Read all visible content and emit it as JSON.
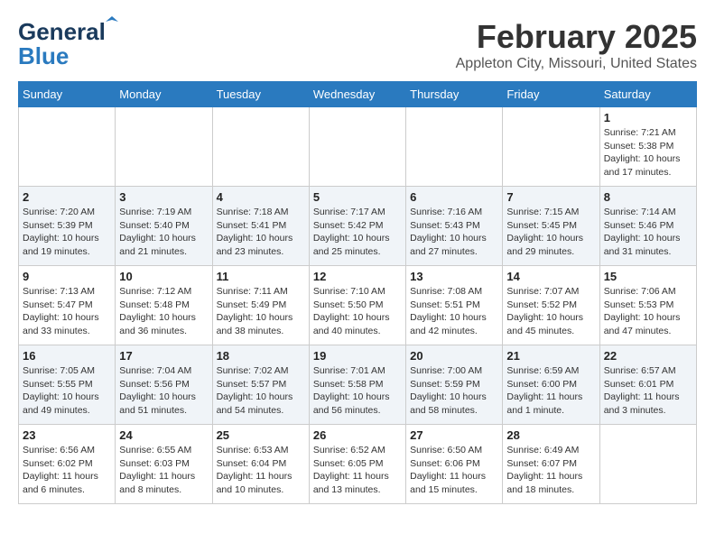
{
  "header": {
    "logo_general": "General",
    "logo_blue": "Blue",
    "month_year": "February 2025",
    "location": "Appleton City, Missouri, United States"
  },
  "weekdays": [
    "Sunday",
    "Monday",
    "Tuesday",
    "Wednesday",
    "Thursday",
    "Friday",
    "Saturday"
  ],
  "weeks": [
    [
      {
        "day": "",
        "info": ""
      },
      {
        "day": "",
        "info": ""
      },
      {
        "day": "",
        "info": ""
      },
      {
        "day": "",
        "info": ""
      },
      {
        "day": "",
        "info": ""
      },
      {
        "day": "",
        "info": ""
      },
      {
        "day": "1",
        "info": "Sunrise: 7:21 AM\nSunset: 5:38 PM\nDaylight: 10 hours\nand 17 minutes."
      }
    ],
    [
      {
        "day": "2",
        "info": "Sunrise: 7:20 AM\nSunset: 5:39 PM\nDaylight: 10 hours\nand 19 minutes."
      },
      {
        "day": "3",
        "info": "Sunrise: 7:19 AM\nSunset: 5:40 PM\nDaylight: 10 hours\nand 21 minutes."
      },
      {
        "day": "4",
        "info": "Sunrise: 7:18 AM\nSunset: 5:41 PM\nDaylight: 10 hours\nand 23 minutes."
      },
      {
        "day": "5",
        "info": "Sunrise: 7:17 AM\nSunset: 5:42 PM\nDaylight: 10 hours\nand 25 minutes."
      },
      {
        "day": "6",
        "info": "Sunrise: 7:16 AM\nSunset: 5:43 PM\nDaylight: 10 hours\nand 27 minutes."
      },
      {
        "day": "7",
        "info": "Sunrise: 7:15 AM\nSunset: 5:45 PM\nDaylight: 10 hours\nand 29 minutes."
      },
      {
        "day": "8",
        "info": "Sunrise: 7:14 AM\nSunset: 5:46 PM\nDaylight: 10 hours\nand 31 minutes."
      }
    ],
    [
      {
        "day": "9",
        "info": "Sunrise: 7:13 AM\nSunset: 5:47 PM\nDaylight: 10 hours\nand 33 minutes."
      },
      {
        "day": "10",
        "info": "Sunrise: 7:12 AM\nSunset: 5:48 PM\nDaylight: 10 hours\nand 36 minutes."
      },
      {
        "day": "11",
        "info": "Sunrise: 7:11 AM\nSunset: 5:49 PM\nDaylight: 10 hours\nand 38 minutes."
      },
      {
        "day": "12",
        "info": "Sunrise: 7:10 AM\nSunset: 5:50 PM\nDaylight: 10 hours\nand 40 minutes."
      },
      {
        "day": "13",
        "info": "Sunrise: 7:08 AM\nSunset: 5:51 PM\nDaylight: 10 hours\nand 42 minutes."
      },
      {
        "day": "14",
        "info": "Sunrise: 7:07 AM\nSunset: 5:52 PM\nDaylight: 10 hours\nand 45 minutes."
      },
      {
        "day": "15",
        "info": "Sunrise: 7:06 AM\nSunset: 5:53 PM\nDaylight: 10 hours\nand 47 minutes."
      }
    ],
    [
      {
        "day": "16",
        "info": "Sunrise: 7:05 AM\nSunset: 5:55 PM\nDaylight: 10 hours\nand 49 minutes."
      },
      {
        "day": "17",
        "info": "Sunrise: 7:04 AM\nSunset: 5:56 PM\nDaylight: 10 hours\nand 51 minutes."
      },
      {
        "day": "18",
        "info": "Sunrise: 7:02 AM\nSunset: 5:57 PM\nDaylight: 10 hours\nand 54 minutes."
      },
      {
        "day": "19",
        "info": "Sunrise: 7:01 AM\nSunset: 5:58 PM\nDaylight: 10 hours\nand 56 minutes."
      },
      {
        "day": "20",
        "info": "Sunrise: 7:00 AM\nSunset: 5:59 PM\nDaylight: 10 hours\nand 58 minutes."
      },
      {
        "day": "21",
        "info": "Sunrise: 6:59 AM\nSunset: 6:00 PM\nDaylight: 11 hours\nand 1 minute."
      },
      {
        "day": "22",
        "info": "Sunrise: 6:57 AM\nSunset: 6:01 PM\nDaylight: 11 hours\nand 3 minutes."
      }
    ],
    [
      {
        "day": "23",
        "info": "Sunrise: 6:56 AM\nSunset: 6:02 PM\nDaylight: 11 hours\nand 6 minutes."
      },
      {
        "day": "24",
        "info": "Sunrise: 6:55 AM\nSunset: 6:03 PM\nDaylight: 11 hours\nand 8 minutes."
      },
      {
        "day": "25",
        "info": "Sunrise: 6:53 AM\nSunset: 6:04 PM\nDaylight: 11 hours\nand 10 minutes."
      },
      {
        "day": "26",
        "info": "Sunrise: 6:52 AM\nSunset: 6:05 PM\nDaylight: 11 hours\nand 13 minutes."
      },
      {
        "day": "27",
        "info": "Sunrise: 6:50 AM\nSunset: 6:06 PM\nDaylight: 11 hours\nand 15 minutes."
      },
      {
        "day": "28",
        "info": "Sunrise: 6:49 AM\nSunset: 6:07 PM\nDaylight: 11 hours\nand 18 minutes."
      },
      {
        "day": "",
        "info": ""
      }
    ]
  ]
}
